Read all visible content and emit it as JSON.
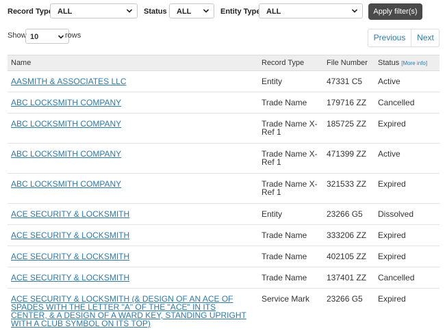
{
  "filters": {
    "record_type": {
      "label": "Record Type",
      "value": "ALL"
    },
    "status": {
      "label": "Status",
      "value": "ALL"
    },
    "entity_type": {
      "label": "Entity Type",
      "value": "ALL"
    },
    "apply_label": "Apply filter(s)"
  },
  "pagination": {
    "show_label": "Show",
    "rows_value": "10",
    "rows_label": "rows",
    "previous_label": "Previous",
    "next_label": "Next"
  },
  "table": {
    "headers": {
      "name": "Name",
      "record_type": "Record Type",
      "file_number": "File Number",
      "status": "Status",
      "more_info": "[More info]"
    },
    "rows": [
      {
        "name": "AASMITH & ASSOCIATES LLC",
        "record_type": "Entity",
        "file_number": "47331 C5",
        "status": "Active"
      },
      {
        "name": "ABC LOCKSMITH COMPANY",
        "record_type": "Trade Name",
        "file_number": "179716 ZZ",
        "status": "Cancelled"
      },
      {
        "name": "ABC LOCKSMITH COMPANY",
        "record_type": "Trade Name X-Ref 1",
        "file_number": "185725 ZZ",
        "status": "Expired"
      },
      {
        "name": "ABC LOCKSMITH COMPANY",
        "record_type": "Trade Name X-Ref 1",
        "file_number": "471399 ZZ",
        "status": "Active"
      },
      {
        "name": "ABC LOCKSMITH COMPANY",
        "record_type": "Trade Name X-Ref 1",
        "file_number": "321533 ZZ",
        "status": "Expired"
      },
      {
        "name": "ACE SECURITY & LOCKSMITH",
        "record_type": "Entity",
        "file_number": "23266 G5",
        "status": "Dissolved"
      },
      {
        "name": "ACE SECURITY & LOCKSMITH",
        "record_type": "Trade Name",
        "file_number": "333206 ZZ",
        "status": "Expired"
      },
      {
        "name": "ACE SECURITY & LOCKSMITH",
        "record_type": "Trade Name",
        "file_number": "402105 ZZ",
        "status": "Expired"
      },
      {
        "name": "ACE SECURITY & LOCKSMITH",
        "record_type": "Trade Name",
        "file_number": "137401 ZZ",
        "status": "Cancelled"
      },
      {
        "name": "ACE SECURITY & LOCKSMITH (& DESIGN OF AN ACE OF SPADES WITH THE LETTER \"A\" OF THE \"ACE\" IN ITS CENTER, & A DESIGN OF A WARD KEY, STANDING UPRIGHT WITH A CLUB SYMBOL ON ITS TOP)",
        "record_type": "Service Mark",
        "file_number": "23266 G5",
        "status": "Expired"
      }
    ]
  }
}
